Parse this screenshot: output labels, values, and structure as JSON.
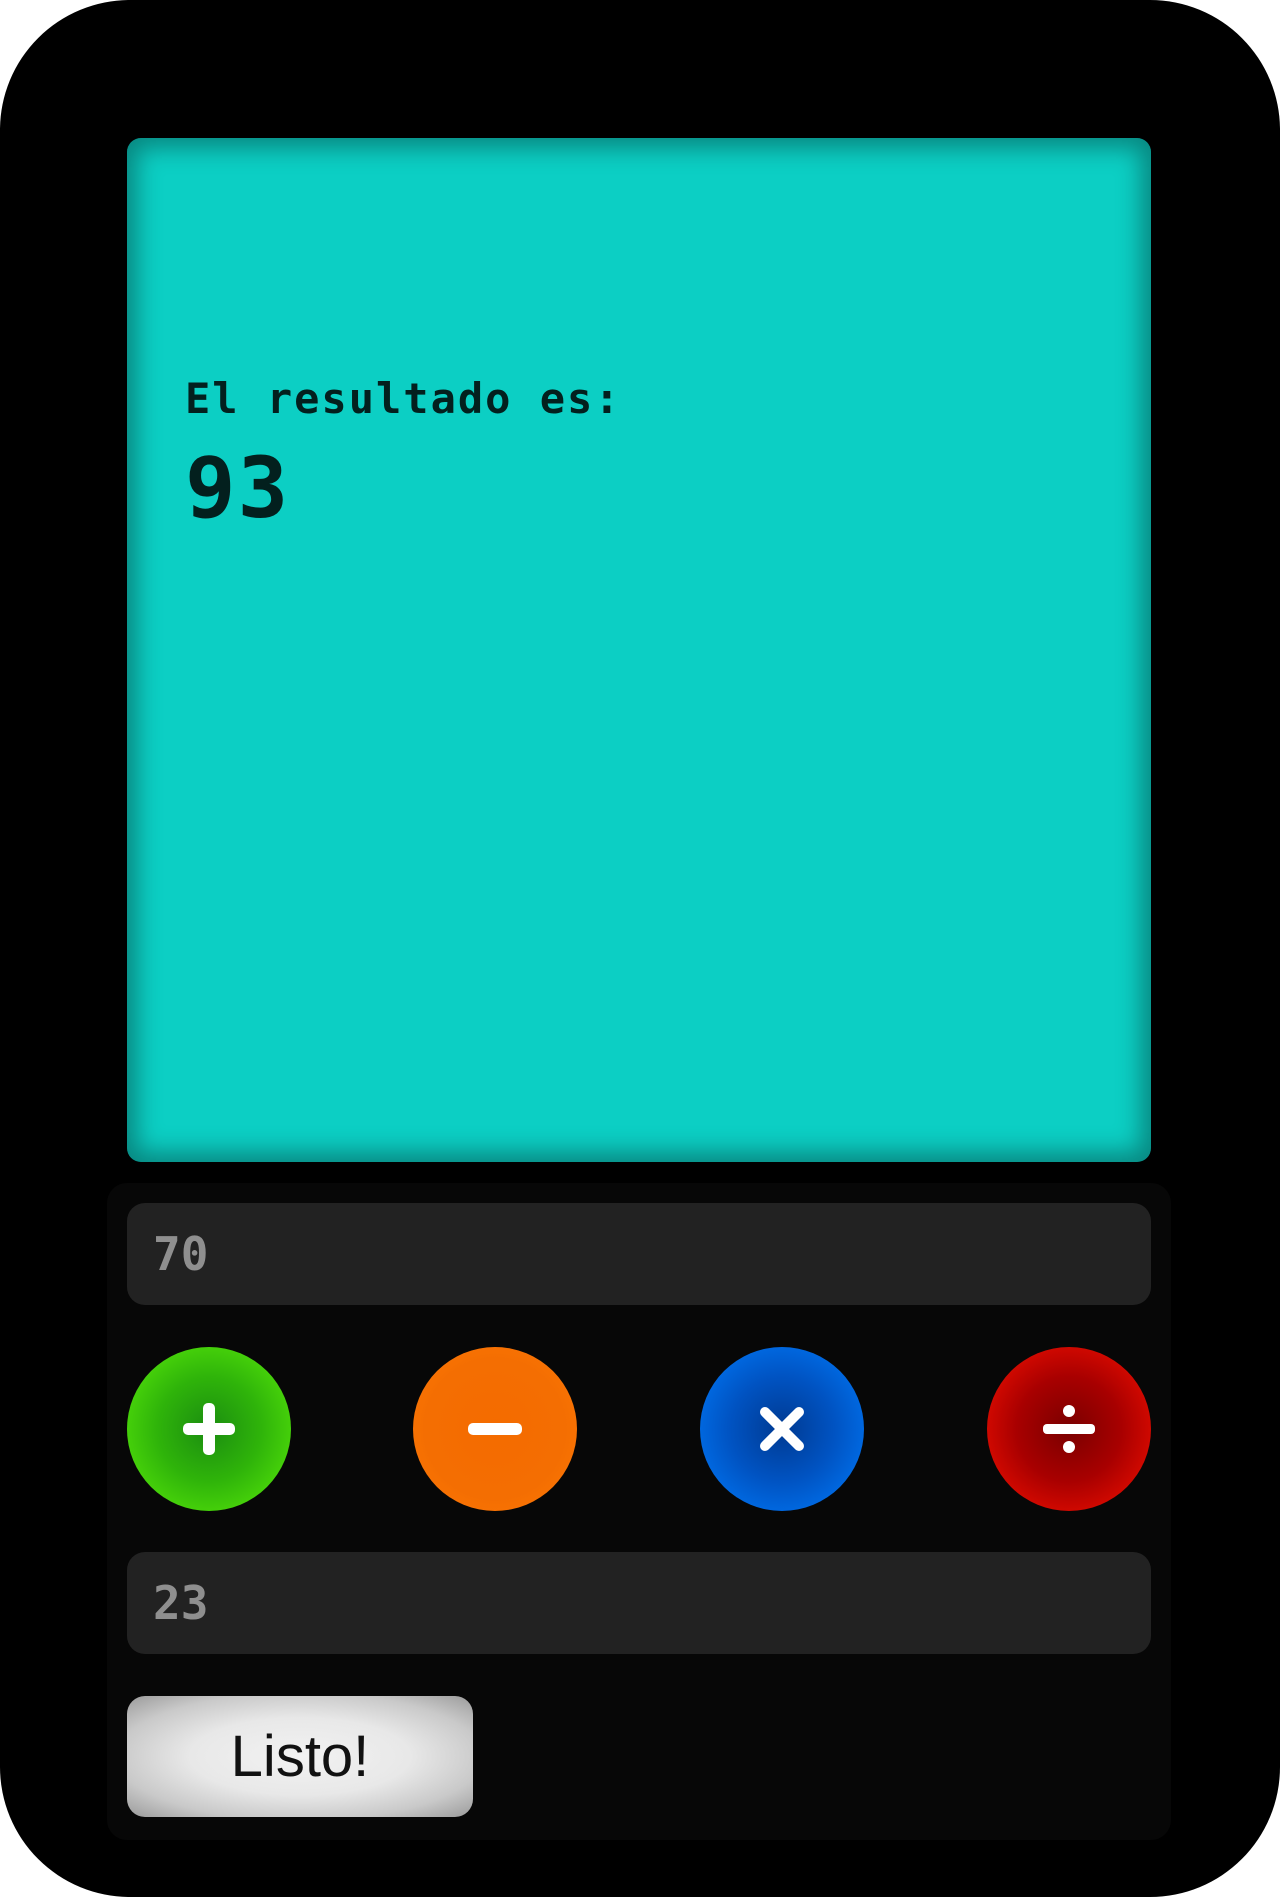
{
  "display": {
    "label": "El resultado es:",
    "value": "93"
  },
  "inputs": {
    "first_value": "70",
    "second_value": "23"
  },
  "operations": [
    {
      "name": "add",
      "icon": "plus-icon",
      "color": "#3cc80a"
    },
    {
      "name": "subtract",
      "icon": "minus-icon",
      "color": "#f46e02"
    },
    {
      "name": "multiply",
      "icon": "times-icon",
      "color": "#0060d8"
    },
    {
      "name": "divide",
      "icon": "divide-icon",
      "color": "#d80800"
    }
  ],
  "submit": {
    "label": "Listo!"
  },
  "colors": {
    "screen": "#0ccfc4",
    "body": "#000000",
    "panel": "#070707",
    "input_bg": "#222222"
  }
}
